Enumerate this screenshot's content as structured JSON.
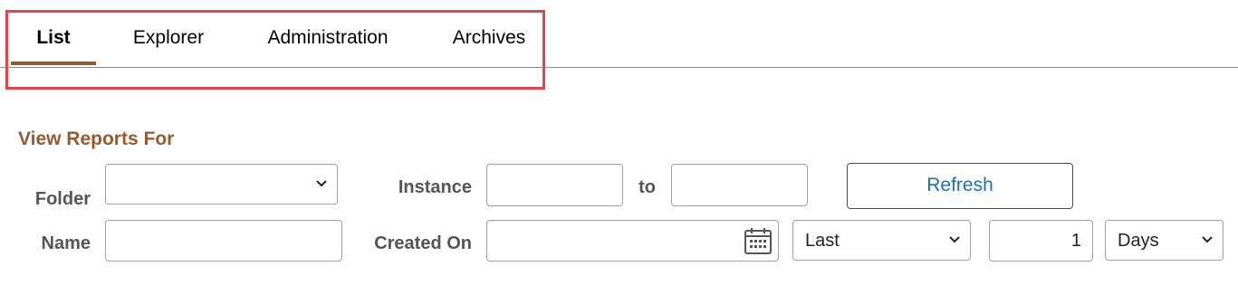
{
  "tabs": [
    {
      "label": "List",
      "active": true
    },
    {
      "label": "Explorer",
      "active": false
    },
    {
      "label": "Administration",
      "active": false
    },
    {
      "label": "Archives",
      "active": false
    }
  ],
  "section": {
    "title": "View Reports For"
  },
  "form": {
    "folder": {
      "label": "Folder",
      "value": ""
    },
    "instance": {
      "label": "Instance",
      "from_value": "",
      "to_label": "to",
      "to_value": ""
    },
    "refresh": {
      "label": "Refresh"
    },
    "name": {
      "label": "Name",
      "value": ""
    },
    "created_on": {
      "label": "Created On",
      "date_value": "",
      "icon": "calendar-icon"
    },
    "range": {
      "value": "Last"
    },
    "count": {
      "value": "1"
    },
    "unit": {
      "value": "Days"
    }
  },
  "colors": {
    "accent": "#9a5a2f",
    "link": "#1f6fb2",
    "highlight": "#e8424b"
  }
}
